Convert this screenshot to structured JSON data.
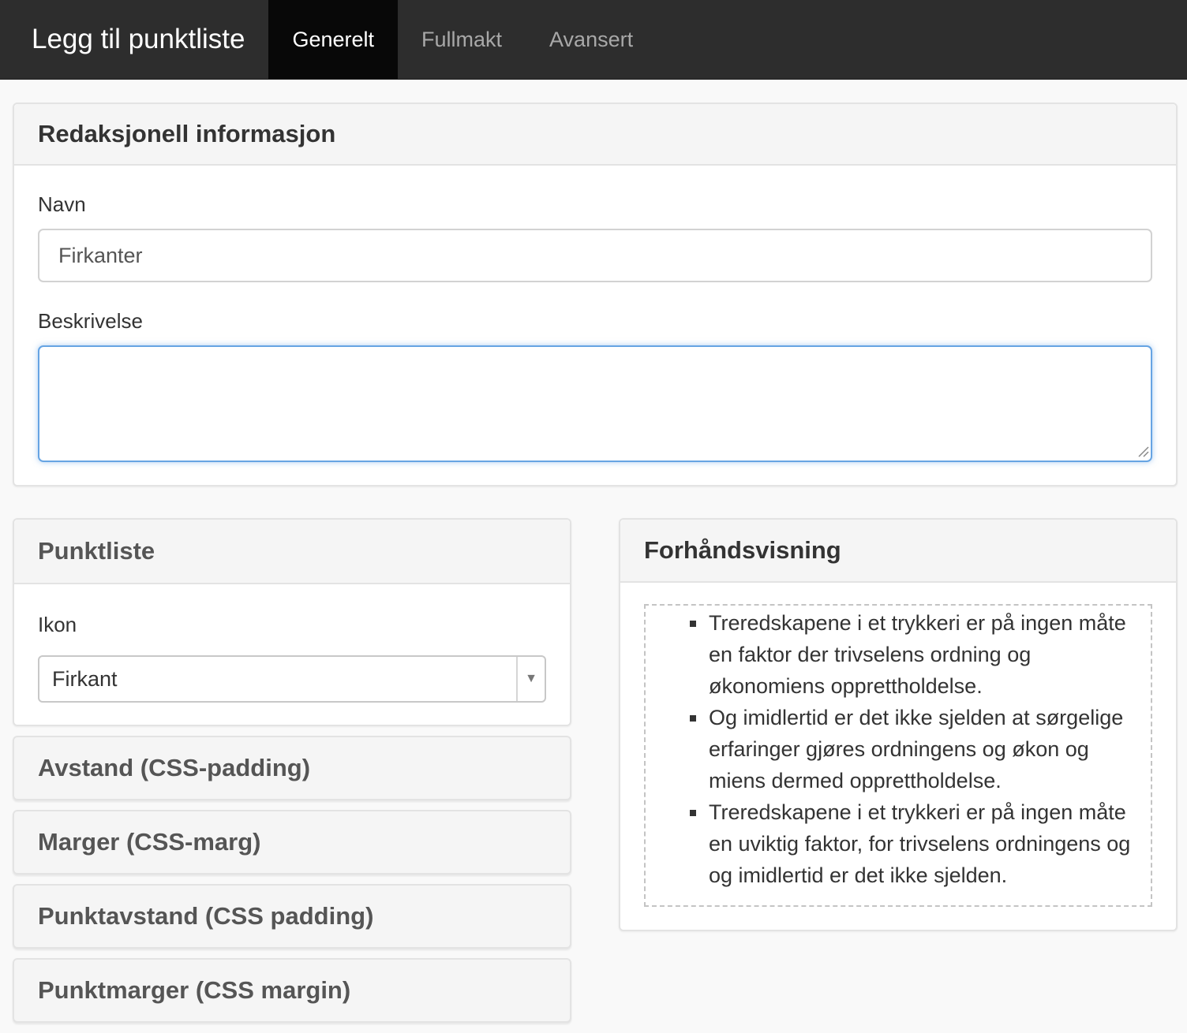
{
  "header": {
    "title": "Legg til punktliste",
    "tabs": [
      {
        "label": "Generelt",
        "active": true
      },
      {
        "label": "Fullmakt",
        "active": false
      },
      {
        "label": "Avansert",
        "active": false
      }
    ]
  },
  "editorial": {
    "heading": "Redaksjonell informasjon",
    "name_label": "Navn",
    "name_value": "Firkanter",
    "description_label": "Beskrivelse",
    "description_value": ""
  },
  "bullet_list": {
    "heading": "Punktliste",
    "icon_label": "Ikon",
    "icon_value": "Firkant",
    "icon_name": "square-bullet-icon"
  },
  "sections": {
    "padding": "Avstand (CSS-padding)",
    "margin": "Marger (CSS-marg)",
    "item_padding": "Punktavstand (CSS padding)",
    "item_margin": "Punktmarger (CSS margin)"
  },
  "preview": {
    "heading": "Forhåndsvisning",
    "items": [
      "Treredskapene i et trykkeri er på ingen måte en faktor der trivselens ordning og økonomiens opprettholdelse.",
      "Og imidlertid er det ikke sjelden at sørgelige erfaringer gjøres ordningens og økon og miens dermed opprettholdelse.",
      "Treredskapene i et trykkeri er på ingen måte en uviktig faktor, for trivselens ordningens og og imidlertid er det ikke sjelden."
    ]
  },
  "colors": {
    "header_bg": "#2d2d2d",
    "active_tab_bg": "#080808",
    "focus_border": "#66a4e3"
  }
}
